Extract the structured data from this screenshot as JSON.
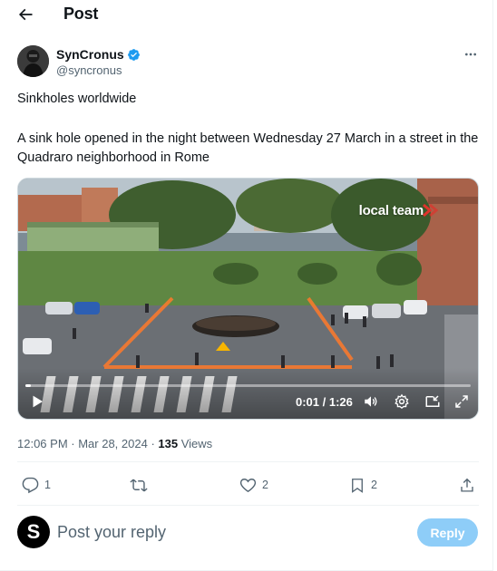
{
  "header": {
    "title": "Post",
    "back_icon": "arrow-left-icon"
  },
  "author": {
    "name": "SynCronus",
    "handle": "@syncronus",
    "verified_icon": "verified-badge-icon",
    "verified_color": "#1d9bf0"
  },
  "more_icon": "more-horizontal-icon",
  "tweet": {
    "line1": "Sinkholes worldwide",
    "line2": "A sink hole opened in the night between Wednesday 27 March in a street in the Quadraro neighborhood in Rome"
  },
  "media": {
    "watermark": "local team",
    "current_time": "0:01",
    "duration": "1:26",
    "time_separator": " / ",
    "progress": 0.012,
    "controls": [
      "play-icon",
      "volume-icon",
      "settings-icon",
      "picture-in-picture-icon",
      "fullscreen-icon"
    ]
  },
  "meta": {
    "time": "12:06 PM",
    "dot1": " · ",
    "date": "Mar 28, 2024",
    "dot2": " · ",
    "views": "135",
    "views_label": " Views"
  },
  "actions": {
    "reply_count": "1",
    "repost_count": "",
    "like_count": "2",
    "bookmark_count": "2"
  },
  "reply": {
    "avatar_letter": "S",
    "placeholder": "Post your reply",
    "button_label": "Reply",
    "button_color": "#8ecdf8"
  }
}
